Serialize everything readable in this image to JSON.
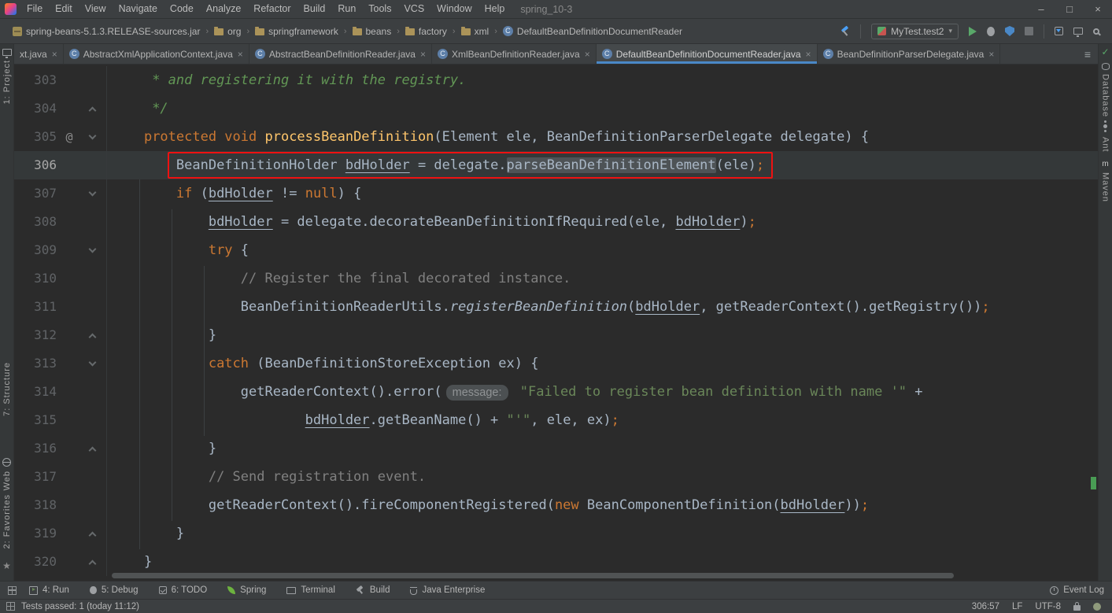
{
  "window": {
    "title": "spring_10-3",
    "menus": [
      "File",
      "Edit",
      "View",
      "Navigate",
      "Code",
      "Analyze",
      "Refactor",
      "Build",
      "Run",
      "Tools",
      "VCS",
      "Window",
      "Help"
    ],
    "controls": [
      {
        "id": "minimize",
        "glyph": "–"
      },
      {
        "id": "maximize",
        "glyph": "□"
      },
      {
        "id": "close",
        "glyph": "×"
      }
    ]
  },
  "glyphs": {
    "close": "×",
    "chevron_down": "▾",
    "crumb_sep": "›",
    "star": "★",
    "check": "✓",
    "class_letter": "C",
    "tabs_list": "≡",
    "maven_letter": "m",
    "annotation_at": "@"
  },
  "breadcrumbs": [
    {
      "label": "spring-beans-5.1.3.RELEASE-sources.jar",
      "icon": "jar"
    },
    {
      "label": "org",
      "icon": "folder"
    },
    {
      "label": "springframework",
      "icon": "folder"
    },
    {
      "label": "beans",
      "icon": "folder"
    },
    {
      "label": "factory",
      "icon": "folder"
    },
    {
      "label": "xml",
      "icon": "folder"
    },
    {
      "label": "DefaultBeanDefinitionDocumentReader",
      "icon": "class"
    }
  ],
  "run": {
    "config": "MyTest.test2"
  },
  "tabs": {
    "active": 4,
    "list": [
      {
        "label": "xt.java",
        "noicon": true
      },
      {
        "label": "AbstractXmlApplicationContext.java"
      },
      {
        "label": "AbstractBeanDefinitionReader.java"
      },
      {
        "label": "XmlBeanDefinitionReader.java"
      },
      {
        "label": "DefaultBeanDefinitionDocumentReader.java"
      },
      {
        "label": "BeanDefinitionParserDelegate.java"
      }
    ]
  },
  "editor": {
    "lines": [
      {
        "n": 303,
        "ind": 5,
        "seg": [
          {
            "t": "* and registering it with the registry.",
            "s": "d"
          }
        ]
      },
      {
        "n": 304,
        "ind": 5,
        "fold": "up",
        "seg": [
          {
            "t": "*/",
            "s": "d"
          }
        ]
      },
      {
        "n": 305,
        "ind": 4,
        "icon": "@",
        "fold": "down",
        "seg": [
          {
            "t": "protected void ",
            "s": "k"
          },
          {
            "t": "processBeanDefinition",
            "s": "m"
          },
          {
            "t": "(Element ele, BeanDefinitionParserDelegate delegate) {",
            "s": "p"
          }
        ]
      },
      {
        "n": 306,
        "ind": 8,
        "caret": true,
        "boxed": true,
        "seg": [
          {
            "t": "BeanDefinitionHolder ",
            "s": "p"
          },
          {
            "t": "bdHolder",
            "s": "v"
          },
          {
            "t": " = delegate.",
            "s": "p"
          },
          {
            "t": "parseBeanDefinitionElement",
            "s": "o"
          },
          {
            "t": "(ele)",
            "s": "p"
          },
          {
            "t": ";",
            "s": "x"
          }
        ]
      },
      {
        "n": 307,
        "ind": 8,
        "fold": "down",
        "seg": [
          {
            "t": "if ",
            "s": "k"
          },
          {
            "t": "(",
            "s": "p"
          },
          {
            "t": "bdHolder",
            "s": "v"
          },
          {
            "t": " != ",
            "s": "p"
          },
          {
            "t": "null",
            "s": "k"
          },
          {
            "t": ") {",
            "s": "p"
          }
        ]
      },
      {
        "n": 308,
        "ind": 12,
        "seg": [
          {
            "t": "bdHolder",
            "s": "v"
          },
          {
            "t": " = delegate.decorateBeanDefinitionIfRequired(ele, ",
            "s": "p"
          },
          {
            "t": "bdHolder",
            "s": "v"
          },
          {
            "t": ")",
            "s": "p"
          },
          {
            "t": ";",
            "s": "x"
          }
        ]
      },
      {
        "n": 309,
        "ind": 12,
        "fold": "down",
        "seg": [
          {
            "t": "try ",
            "s": "k"
          },
          {
            "t": "{",
            "s": "p"
          }
        ]
      },
      {
        "n": 310,
        "ind": 16,
        "seg": [
          {
            "t": "// Register the final decorated instance.",
            "s": "c"
          }
        ]
      },
      {
        "n": 311,
        "ind": 16,
        "seg": [
          {
            "t": "BeanDefinitionReaderUtils.",
            "s": "p"
          },
          {
            "t": "registerBeanDefinition",
            "s": "i"
          },
          {
            "t": "(",
            "s": "p"
          },
          {
            "t": "bdHolder",
            "s": "v"
          },
          {
            "t": ", getReaderContext().getRegistry())",
            "s": "p"
          },
          {
            "t": ";",
            "s": "x"
          }
        ]
      },
      {
        "n": 312,
        "ind": 12,
        "fold": "up",
        "seg": [
          {
            "t": "}",
            "s": "p"
          }
        ]
      },
      {
        "n": 313,
        "ind": 12,
        "fold": "down",
        "seg": [
          {
            "t": "catch ",
            "s": "k"
          },
          {
            "t": "(BeanDefinitionStoreException ex) {",
            "s": "p"
          }
        ]
      },
      {
        "n": 314,
        "ind": 16,
        "seg": [
          {
            "t": "getReaderContext().error(",
            "s": "p"
          },
          {
            "t": "message:",
            "s": "h"
          },
          {
            "t": " ",
            "s": "p"
          },
          {
            "t": "\"Failed to register bean definition with name '\"",
            "s": "s"
          },
          {
            "t": " +",
            "s": "p"
          }
        ]
      },
      {
        "n": 315,
        "ind": 24,
        "seg": [
          {
            "t": "bdHolder",
            "s": "v"
          },
          {
            "t": ".getBeanName() + ",
            "s": "p"
          },
          {
            "t": "\"'\"",
            "s": "s"
          },
          {
            "t": ", ele, ex)",
            "s": "p"
          },
          {
            "t": ";",
            "s": "x"
          }
        ]
      },
      {
        "n": 316,
        "ind": 12,
        "fold": "up",
        "seg": [
          {
            "t": "}",
            "s": "p"
          }
        ]
      },
      {
        "n": 317,
        "ind": 12,
        "seg": [
          {
            "t": "// Send registration event.",
            "s": "c"
          }
        ]
      },
      {
        "n": 318,
        "ind": 12,
        "seg": [
          {
            "t": "getReaderContext().fireComponentRegistered(",
            "s": "p"
          },
          {
            "t": "new",
            "s": "k"
          },
          {
            "t": " BeanComponentDefinition(",
            "s": "p"
          },
          {
            "t": "bdHolder",
            "s": "v"
          },
          {
            "t": "))",
            "s": "p"
          },
          {
            "t": ";",
            "s": "x"
          }
        ]
      },
      {
        "n": 319,
        "ind": 8,
        "fold": "up",
        "seg": [
          {
            "t": "}",
            "s": "p"
          }
        ]
      },
      {
        "n": 320,
        "ind": 4,
        "fold": "up",
        "seg": [
          {
            "t": "}",
            "s": "p"
          }
        ]
      }
    ]
  },
  "stripes": {
    "left": [
      {
        "id": "project",
        "label": "1: Project",
        "icon": "monitor"
      },
      {
        "id": "structure",
        "label": "7: Structure"
      },
      {
        "id": "web",
        "label": "Web",
        "icon": "globe"
      },
      {
        "id": "favorites",
        "label": "2: Favorites"
      }
    ],
    "right": [
      {
        "id": "database",
        "label": "Database",
        "icon": "db"
      },
      {
        "id": "ant",
        "label": "Ant",
        "icon": "ant"
      },
      {
        "id": "maven",
        "label": "Maven",
        "icon": "maven"
      }
    ]
  },
  "toolwindows": {
    "buttons": [
      {
        "id": "run",
        "label": "4: Run",
        "icon": "runwin"
      },
      {
        "id": "debug",
        "label": "5: Debug",
        "icon": "bugsm"
      },
      {
        "id": "todo",
        "label": "6: TODO",
        "icon": "todo"
      },
      {
        "id": "spring",
        "label": "Spring",
        "icon": "spring"
      },
      {
        "id": "terminal",
        "label": "Terminal",
        "icon": "terminal"
      },
      {
        "id": "build",
        "label": "Build",
        "icon": "hammergray"
      },
      {
        "id": "javaee",
        "label": "Java Enterprise",
        "icon": "cup"
      }
    ],
    "event_log": "Event Log"
  },
  "status": {
    "left": "Tests passed: 1 (today 11:12)",
    "caret": "306:57",
    "line_ending": "LF",
    "encoding": "UTF-8"
  },
  "colors": {
    "bg": "#2b2b2b",
    "bar": "#3c3f41",
    "stripe": "#353839",
    "border": "#303233",
    "uitext": "#bbbbbb",
    "fg": "#a9b7c6",
    "kw": "#cc7832",
    "str": "#6a8759",
    "cmt": "#808080",
    "doc": "#629755",
    "mth": "#ffc66b",
    "lnum": "#606366",
    "occ": "#4e5356",
    "caretrow": "#343839",
    "red": "#ee1111",
    "accent": "#4a88c7",
    "green": "#59a869",
    "marker": "#499c54",
    "hintbg": "#4c5052",
    "hintfg": "#909395"
  }
}
